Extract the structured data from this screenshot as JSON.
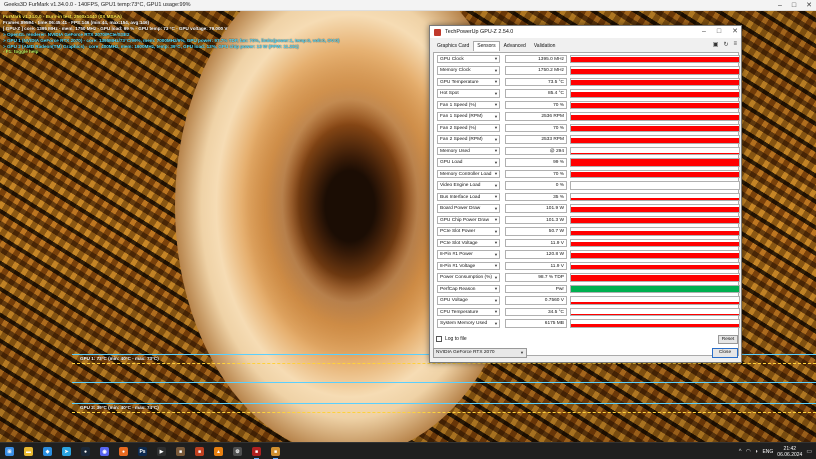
{
  "furmark": {
    "title": "Geeks3D FurMark v1.34.0.0 - 140FPS, GPU1 temp:73°C, GPU1 usage:99%",
    "osd": [
      {
        "text": "FurMark v1.34.0.0 - Burn-in test, 2560x1440 (0X MSAA)",
        "color": "yellow"
      },
      {
        "text": "Frames:89594 - time:06:45:41 - FPS:146 (min:44, max:154, avg:146)",
        "color": "white"
      },
      {
        "text": "[ GPU-Z ] core: 1395 MHz - mem: 1750 MHz - GPU load: 99 % - GPU temp: 73 °C - GPU voltage: 79.000 V",
        "color": "white"
      },
      {
        "text": "> OpenGL renderer: NVIDIA GeForce RTX 2070/PCIe/SSE2",
        "color": "cyan"
      },
      {
        "text": "> GPU 1 (NVIDIA GeForce RTX 2070) - core: 1395MHz/73°C/99%, mem: 7000MHz/9%, GPU power: 97.7% TDP, fan: 70%, limits(power:1, temp:0, volt:0, OV:0)",
        "color": "cyan"
      },
      {
        "text": "> GPU 2 (AMD Radeon(TM) Graphics) - core: 400MHz, mem: 1600MHz, temp: 39°C, GPU load: 13%, GPU chip power: 13 W (PPW: 11.231)",
        "color": "cyan"
      },
      {
        "text": "- F1: toggle help",
        "color": "lime"
      }
    ],
    "graphs": [
      {
        "label": "GPU 1: 73°C (min: 40°C - max: 73°C)"
      },
      {
        "label": "GPU 2: 39°C (min: 40°C - max: 74°C)"
      }
    ]
  },
  "gpuz": {
    "title": "TechPowerUp GPU-Z 2.54.0",
    "tabs": [
      "Graphics Card",
      "Sensors",
      "Advanced",
      "Validation"
    ],
    "active_tab": "Sensors",
    "tool_icons": [
      "camera-icon",
      "refresh-icon",
      "menu-icon"
    ],
    "sensors": [
      {
        "name": "GPU Clock",
        "value": "1395.0 MHz",
        "level": 0.75,
        "color": "#ff0000"
      },
      {
        "name": "Memory Clock",
        "value": "1750.2 MHz",
        "level": 0.75,
        "color": "#ff0000"
      },
      {
        "name": "GPU Temperature",
        "value": "73.5 °C",
        "level": 0.75,
        "color": "#ff0000"
      },
      {
        "name": "Hot Spot",
        "value": "85.4 °C",
        "level": 0.75,
        "color": "#ff0000"
      },
      {
        "name": "Fan 1 Speed (%)",
        "value": "70 %",
        "level": 0.75,
        "color": "#ff0000"
      },
      {
        "name": "Fan 1 Speed (RPM)",
        "value": "2536 RPM",
        "level": 0.75,
        "color": "#ff0000"
      },
      {
        "name": "Fan 2 Speed (%)",
        "value": "70 %",
        "level": 0.75,
        "color": "#ff0000"
      },
      {
        "name": "Fan 2 Speed (RPM)",
        "value": "2533 RPM",
        "level": 0.75,
        "color": "#ff0000"
      },
      {
        "name": "Memory Used",
        "value": "@ 294",
        "level": 0.1,
        "color": "#ff0000"
      },
      {
        "name": "GPU Load",
        "value": "99 %",
        "level": 0.95,
        "color": "#ff0000"
      },
      {
        "name": "Memory Controller Load",
        "value": "70 %",
        "level": 0.7,
        "color": "#ff0000"
      },
      {
        "name": "Video Engine Load",
        "value": "0 %",
        "level": 0,
        "color": "#ff0000"
      },
      {
        "name": "Bus Interface Load",
        "value": "35 %",
        "level": 0.3,
        "color": "#ff0000"
      },
      {
        "name": "Board Power Draw",
        "value": "101.9 W",
        "level": 0.7,
        "color": "#ff0000"
      },
      {
        "name": "GPU Chip Power Draw",
        "value": "101.3 W",
        "level": 0.7,
        "color": "#ff0000"
      },
      {
        "name": "PCIe Slot Power",
        "value": "50.7 W",
        "level": 0.6,
        "color": "#ff0000"
      },
      {
        "name": "PCIe Slot Voltage",
        "value": "11.9 V",
        "level": 0.6,
        "color": "#ff0000"
      },
      {
        "name": "8-Pin #1 Power",
        "value": "120.8 W",
        "level": 0.7,
        "color": "#ff0000"
      },
      {
        "name": "8-Pin #1 Voltage",
        "value": "11.9 V",
        "level": 0.6,
        "color": "#ff0000"
      },
      {
        "name": "Power Consumption (%)",
        "value": "98.7 % TDP",
        "level": 0.9,
        "color": "#ff0000"
      },
      {
        "name": "PerfCap Reason",
        "value": "Pwr",
        "level": 1,
        "color": "#00b050"
      },
      {
        "name": "GPU Voltage",
        "value": "0.7560 V",
        "level": 0.3,
        "color": "#ff0000"
      },
      {
        "name": "CPU Temperature",
        "value": "34.5 °C",
        "level": 0.15,
        "color": "#ff0000"
      },
      {
        "name": "System Memory Used",
        "value": "6175 MB",
        "level": 0.35,
        "color": "#ff0000"
      }
    ],
    "log_label": "Log to file",
    "reset_label": "Reset",
    "gpu_select": "NVIDIA GeForce RTX 2070",
    "close_label": "Close"
  },
  "taskbar": {
    "apps": [
      {
        "name": "start-icon",
        "glyph": "⊞",
        "color": "#3a8ee6"
      },
      {
        "name": "file-explorer-icon",
        "glyph": "▬",
        "color": "#e8b830"
      },
      {
        "name": "vscode-icon",
        "glyph": "◆",
        "color": "#2a8ee0"
      },
      {
        "name": "telegram-icon",
        "glyph": "➤",
        "color": "#2aa3e0"
      },
      {
        "name": "steam-icon",
        "glyph": "●",
        "color": "#1b2838"
      },
      {
        "name": "discord-icon",
        "glyph": "◉",
        "color": "#5865f2"
      },
      {
        "name": "browser-icon",
        "glyph": "●",
        "color": "#e86a20"
      },
      {
        "name": "photoshop-icon",
        "glyph": "Ps",
        "color": "#0d2a50"
      },
      {
        "name": "media-icon",
        "glyph": "▶",
        "color": "#303030"
      },
      {
        "name": "app-icon",
        "glyph": "■",
        "color": "#7a5a3a"
      },
      {
        "name": "app-icon-2",
        "glyph": "■",
        "color": "#c04020"
      },
      {
        "name": "vlc-icon",
        "glyph": "▲",
        "color": "#e88010"
      },
      {
        "name": "settings-icon",
        "glyph": "⚙",
        "color": "#505050"
      },
      {
        "name": "gpuz-icon",
        "glyph": "■",
        "color": "#b02020"
      },
      {
        "name": "furmark-icon",
        "glyph": "■",
        "color": "#d09030"
      }
    ],
    "tray": {
      "chevron": "^",
      "language": "ENG",
      "time": "21:42",
      "date": "06.06.2024"
    }
  }
}
